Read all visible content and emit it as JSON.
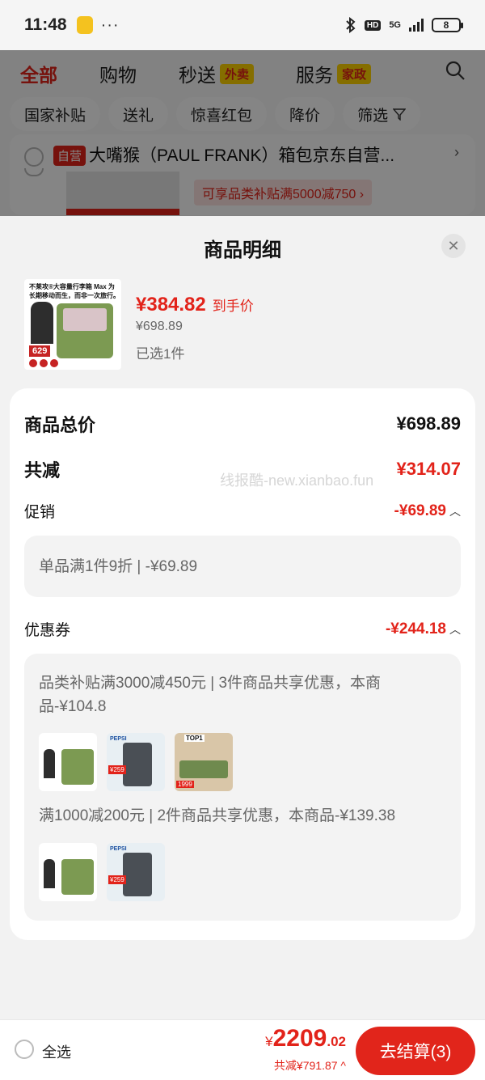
{
  "status": {
    "time": "11:48",
    "dots": "···",
    "hd": "HD",
    "net": "5G",
    "battery": "8"
  },
  "tabs": [
    {
      "label": "全部"
    },
    {
      "label": "购物"
    },
    {
      "label": "秒送",
      "badge": "外卖"
    },
    {
      "label": "服务",
      "badge": "家政"
    }
  ],
  "filters": [
    "国家补贴",
    "送礼",
    "惊喜红包",
    "降价",
    "筛选"
  ],
  "shop": {
    "badge": "自营",
    "name": "大嘴猴（PAUL FRANK）箱包京东自营...",
    "subsidy": "可享品类补贴满5000减750 ›"
  },
  "sheet": {
    "title": "商品明细",
    "product": {
      "price": "¥384.82",
      "price_label": "到手价",
      "original": "¥698.89",
      "selected": "已选1件",
      "img_title": "不莱攻®大容量行李箱 Max 为长期移动而生，而非一次旅行。",
      "img_price": "629"
    },
    "total_label": "商品总价",
    "total_value": "¥698.89",
    "reduce_label": "共减",
    "reduce_value": "¥314.07",
    "promo_label": "促销",
    "promo_value": "-¥69.89",
    "promo_detail": "单品满1件9折 | -¥69.89",
    "coupon_label": "优惠券",
    "coupon_value": "-¥244.18",
    "coupon1_line1": "品类补贴满3000减450元 | 3件商品共享优惠，本商",
    "coupon1_line2": "品-¥104.8",
    "coupon2_line": "满1000减200元 | 2件商品共享优惠，本商品-¥139.38",
    "thumbs": {
      "pepsi": "PEPSI",
      "price259": "¥259",
      "top1": "TOP1",
      "price1999": "1999"
    }
  },
  "watermark": "线报酷-new.xianbao.fun",
  "bottom": {
    "select_all": "全选",
    "yen": "¥",
    "total_int": "2209",
    "total_dec": ".02",
    "saved": "共减¥791.87 ^",
    "checkout": "去结算(3)"
  },
  "colors": {
    "brand_red": "#e2231a",
    "checkout_red": "#e1251b"
  }
}
